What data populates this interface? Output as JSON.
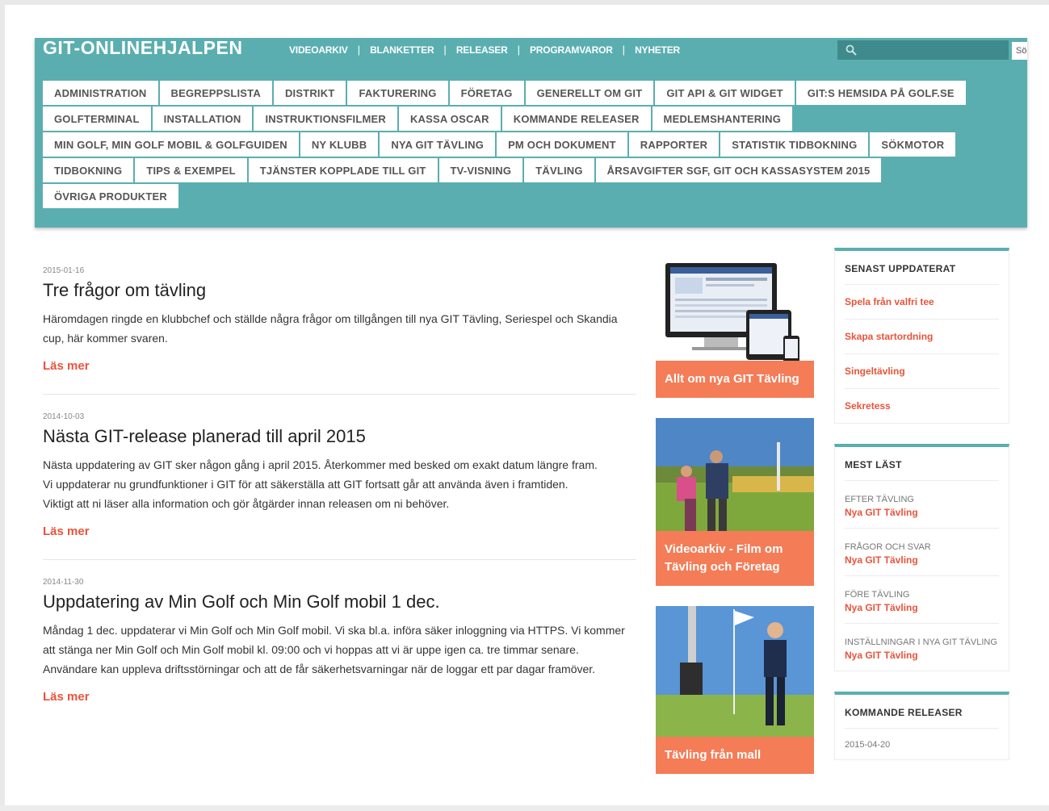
{
  "site_title": "GIT-ONLINEHJALPEN",
  "topnav": [
    "VIDEOARKIV",
    "BLANKETTER",
    "RELEASER",
    "PROGRAMVAROR",
    "NYHETER"
  ],
  "search": {
    "button_label": "Sö",
    "placeholder": ""
  },
  "categories": [
    "ADMINISTRATION",
    "BEGREPPSLISTA",
    "DISTRIKT",
    "FAKTURERING",
    "FÖRETAG",
    "GENERELLT OM GIT",
    "GIT API & GIT WIDGET",
    "GIT:S HEMSIDA PÅ GOLF.SE",
    "GOLFTERMINAL",
    "INSTALLATION",
    "INSTRUKTIONSFILMER",
    "KASSA OSCAR",
    "KOMMANDE RELEASER",
    "MEDLEMSHANTERING",
    "MIN GOLF, MIN GOLF MOBIL & GOLFGUIDEN",
    "NY KLUBB",
    "NYA GIT TÄVLING",
    "PM OCH DOKUMENT",
    "RAPPORTER",
    "STATISTIK TIDBOKNING",
    "SÖKMOTOR",
    "TIDBOKNING",
    "TIPS & EXEMPEL",
    "TJÄNSTER KOPPLADE TILL GIT",
    "TV-VISNING",
    "TÄVLING",
    "ÅRSAVGIFTER SGF, GIT OCH KASSASYSTEM 2015",
    "ÖVRIGA PRODUKTER"
  ],
  "articles": [
    {
      "date": "2015-01-16",
      "title": "Tre frågor om tävling",
      "paragraphs": [
        "Häromdagen ringde en klubbchef och ställde några frågor om tillgången till nya GIT Tävling, Seriespel och Skandia cup, här kommer svaren."
      ],
      "readmore": "Läs mer"
    },
    {
      "date": "2014-10-03",
      "title": "Nästa GIT-release planerad till april 2015",
      "paragraphs": [
        "Nästa uppdatering av GIT sker någon gång i april 2015. Återkommer med besked om exakt datum längre fram.",
        "Vi uppdaterar nu grundfunktioner i GIT för att säkerställa att GIT fortsatt går att använda även i framtiden.",
        "Viktigt att ni läser alla information och gör åtgärder innan releasen om ni behöver."
      ],
      "readmore": "Läs mer"
    },
    {
      "date": "2014-11-30",
      "title": "Uppdatering av Min Golf och Min Golf mobil 1 dec.",
      "paragraphs": [
        "Måndag 1 dec. uppdaterar vi Min Golf och Min Golf mobil. Vi ska bl.a. införa säker inloggning via HTTPS. Vi kommer att stänga ner Min Golf och Min Golf mobil kl. 09:00 och vi hoppas att vi är uppe igen ca. tre timmar senare.",
        "Användare kan uppleva driftsstörningar och att de får säkerhetsvarningar när de loggar ett par dagar framöver."
      ],
      "readmore": "Läs mer"
    }
  ],
  "promos": [
    {
      "caption": "Allt om nya GIT Tävling"
    },
    {
      "caption": "Videoarkiv - Film om Tävling och Företag"
    },
    {
      "caption": "Tävling från mall"
    }
  ],
  "sidebar": {
    "recent": {
      "title": "SENAST UPPDATERAT",
      "links": [
        "Spela från valfri tee",
        "Skapa startordning",
        "Singeltävling",
        "Sekretess"
      ]
    },
    "most_read": {
      "title": "MEST LÄST",
      "items": [
        {
          "category": "EFTER TÄVLING",
          "link": "Nya GIT Tävling"
        },
        {
          "category": "FRÅGOR OCH SVAR",
          "link": "Nya GIT Tävling"
        },
        {
          "category": "FÖRE TÄVLING",
          "link": "Nya GIT Tävling"
        },
        {
          "category": "INSTÄLLNINGAR I NYA GIT TÄVLING",
          "link": "Nya GIT Tävling"
        }
      ]
    },
    "releases": {
      "title": "KOMMANDE RELEASER",
      "date": "2015-04-20"
    }
  },
  "colors": {
    "teal": "#5aaeb0",
    "accent": "#e8543a",
    "promo": "#f47c57"
  }
}
